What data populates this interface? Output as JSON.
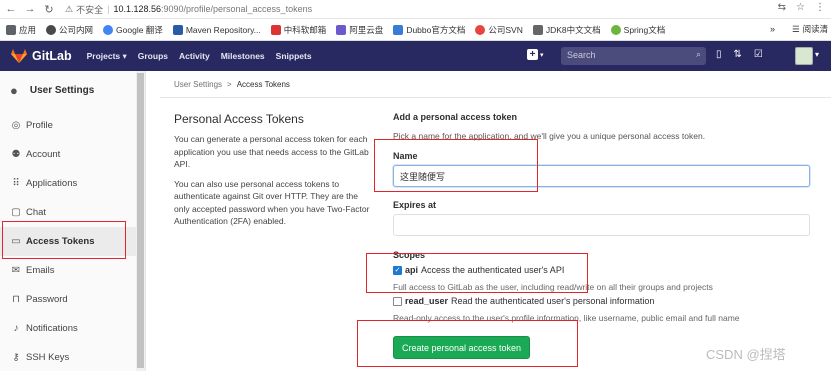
{
  "browser": {
    "insecure_label": "不安全",
    "url_host": "10.1.128.56",
    "url_path": ":9090/profile/personal_access_tokens",
    "bookmarks": [
      {
        "label": "应用",
        "color": "#5f6368"
      },
      {
        "label": "公司内网",
        "color": "#4a4a4a"
      },
      {
        "label": "Google 翻译",
        "color": "#4285f4"
      },
      {
        "label": "Maven Repository...",
        "color": "#2a5ba8"
      },
      {
        "label": "中科软邮箱",
        "color": "#d33"
      },
      {
        "label": "阿里云盘",
        "color": "#6a5acd"
      },
      {
        "label": "Dubbo官方文档",
        "color": "#3a7bd5"
      },
      {
        "label": "公司SVN",
        "color": "#e8453c"
      },
      {
        "label": "JDK8中文文档",
        "color": "#666"
      },
      {
        "label": "Spring文档",
        "color": "#6db33f"
      }
    ],
    "more": "»",
    "reading_list": "阅读清"
  },
  "header": {
    "brand": "GitLab",
    "nav": [
      "Projects ▾",
      "Groups",
      "Activity",
      "Milestones",
      "Snippets"
    ],
    "search_placeholder": "Search",
    "accent": "#292961"
  },
  "sidebar": {
    "title": "User Settings",
    "items": [
      {
        "label": "Profile",
        "icon": "profile-icon"
      },
      {
        "label": "Account",
        "icon": "account-icon"
      },
      {
        "label": "Applications",
        "icon": "applications-icon"
      },
      {
        "label": "Chat",
        "icon": "chat-icon"
      },
      {
        "label": "Access Tokens",
        "icon": "key-icon",
        "active": true
      },
      {
        "label": "Emails",
        "icon": "mail-icon"
      },
      {
        "label": "Password",
        "icon": "lock-icon"
      },
      {
        "label": "Notifications",
        "icon": "bell-icon"
      },
      {
        "label": "SSH Keys",
        "icon": "ssh-key-icon"
      }
    ]
  },
  "breadcrumb": {
    "parent": "User Settings",
    "separator": ">",
    "current": "Access Tokens"
  },
  "intro": {
    "title": "Personal Access Tokens",
    "p1": "You can generate a personal access token for each application you use that needs access to the GitLab API.",
    "p2": "You can also use personal access tokens to authenticate against Git over HTTP. They are the only accepted password when you have Two-Factor Authentication (2FA) enabled."
  },
  "form": {
    "heading": "Add a personal access token",
    "subheading": "Pick a name for the application, and we'll give you a unique personal access token.",
    "name_label": "Name",
    "name_value": "这里随便写",
    "expires_label": "Expires at",
    "expires_value": "",
    "scopes_label": "Scopes",
    "scopes": [
      {
        "name": "api",
        "desc": "Access the authenticated user's API",
        "checked": true,
        "help": "Full access to GitLab as the user, including read/write on all their groups and projects"
      },
      {
        "name": "read_user",
        "desc": "Read the authenticated user's personal information",
        "checked": false,
        "help": "Read-only access to the user's profile information, like username, public email and full name"
      }
    ],
    "submit_label": "Create personal access token",
    "submit_color": "#1aaa55"
  },
  "watermark": "CSDN @捏塔"
}
